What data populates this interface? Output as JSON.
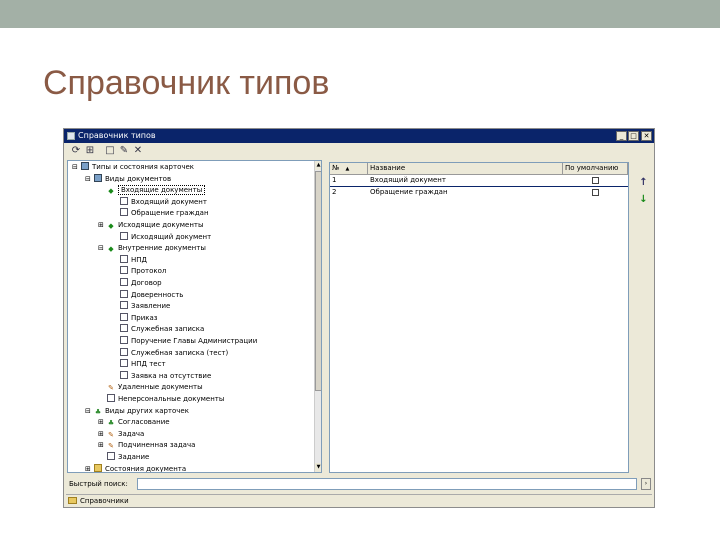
{
  "slide": {
    "title": "Справочник типов"
  },
  "window": {
    "title": "Справочник типов",
    "min_icon": "_",
    "max_icon": "□",
    "close_icon": "✕"
  },
  "toolbar": [
    {
      "icon": "refresh-icon",
      "glyph": "⟳"
    },
    {
      "icon": "tree-icon",
      "glyph": "⊞"
    },
    {
      "icon": "add-icon",
      "glyph": "□"
    },
    {
      "icon": "edit-icon",
      "glyph": "✎"
    },
    {
      "icon": "delete-icon",
      "glyph": "✕"
    }
  ],
  "tree": [
    {
      "label": "Типы и состояния карточек",
      "icon": "book",
      "depth": 0,
      "exp": "⊟"
    },
    {
      "label": "Виды документов",
      "icon": "book",
      "depth": 1,
      "exp": "⊟"
    },
    {
      "label": "Входящие документы",
      "icon": "green",
      "depth": 2,
      "exp": "",
      "selected": true
    },
    {
      "label": "Входящий документ",
      "icon": "doc",
      "depth": 3,
      "exp": ""
    },
    {
      "label": "Обращение граждан",
      "icon": "doc",
      "depth": 3,
      "exp": ""
    },
    {
      "label": "Исходящие документы",
      "icon": "green",
      "depth": 2,
      "exp": "⊞"
    },
    {
      "label": "Исходящий документ",
      "icon": "doc",
      "depth": 3,
      "exp": ""
    },
    {
      "label": "Внутренние документы",
      "icon": "green",
      "depth": 2,
      "exp": "⊟"
    },
    {
      "label": "НПД",
      "icon": "doc",
      "depth": 3,
      "exp": ""
    },
    {
      "label": "Протокол",
      "icon": "doc",
      "depth": 3,
      "exp": ""
    },
    {
      "label": "Договор",
      "icon": "doc",
      "depth": 3,
      "exp": ""
    },
    {
      "label": "Доверенность",
      "icon": "doc",
      "depth": 3,
      "exp": ""
    },
    {
      "label": "Заявление",
      "icon": "doc",
      "depth": 3,
      "exp": ""
    },
    {
      "label": "Приказ",
      "icon": "doc",
      "depth": 3,
      "exp": ""
    },
    {
      "label": "Служебная записка",
      "icon": "doc",
      "depth": 3,
      "exp": ""
    },
    {
      "label": "Поручение Главы Администрации",
      "icon": "doc",
      "depth": 3,
      "exp": ""
    },
    {
      "label": "Служебная записка (тест)",
      "icon": "doc",
      "depth": 3,
      "exp": ""
    },
    {
      "label": "НПД тест",
      "icon": "doc",
      "depth": 3,
      "exp": ""
    },
    {
      "label": "Заявка на отсутствие",
      "icon": "doc",
      "depth": 3,
      "exp": ""
    },
    {
      "label": "Удаленные документы",
      "icon": "hw",
      "depth": 2,
      "exp": ""
    },
    {
      "label": "Неперсональные документы",
      "icon": "doc",
      "depth": 2,
      "exp": ""
    },
    {
      "label": "Виды других карточек",
      "icon": "people",
      "depth": 1,
      "exp": "⊟"
    },
    {
      "label": "Согласование",
      "icon": "people",
      "depth": 2,
      "exp": "⊞"
    },
    {
      "label": "Задача",
      "icon": "hw",
      "depth": 2,
      "exp": "⊞"
    },
    {
      "label": "Подчиненная задача",
      "icon": "hw",
      "depth": 2,
      "exp": "⊞"
    },
    {
      "label": "Задание",
      "icon": "doc",
      "depth": 2,
      "exp": ""
    },
    {
      "label": "Состояния документа",
      "icon": "folder",
      "depth": 1,
      "exp": "⊞"
    }
  ],
  "grid": {
    "columns": [
      "№",
      "Название",
      "По умолчанию"
    ],
    "sort_indicator": "▲",
    "rows": [
      {
        "num": "1",
        "name": "Входящий документ",
        "default": false
      },
      {
        "num": "2",
        "name": "Обращение граждан",
        "default": false
      }
    ]
  },
  "side_buttons": [
    {
      "name": "move-up",
      "glyph": "↑"
    },
    {
      "name": "move-down",
      "glyph": "↓"
    }
  ],
  "search": {
    "label": "Быстрый поиск:",
    "value": "",
    "button": "›"
  },
  "status": {
    "label": "Справочники"
  },
  "colors": {
    "title_text": "#8a5a45",
    "top_bar": "#a3b0a6",
    "window_title_bg": "#0a246a"
  }
}
